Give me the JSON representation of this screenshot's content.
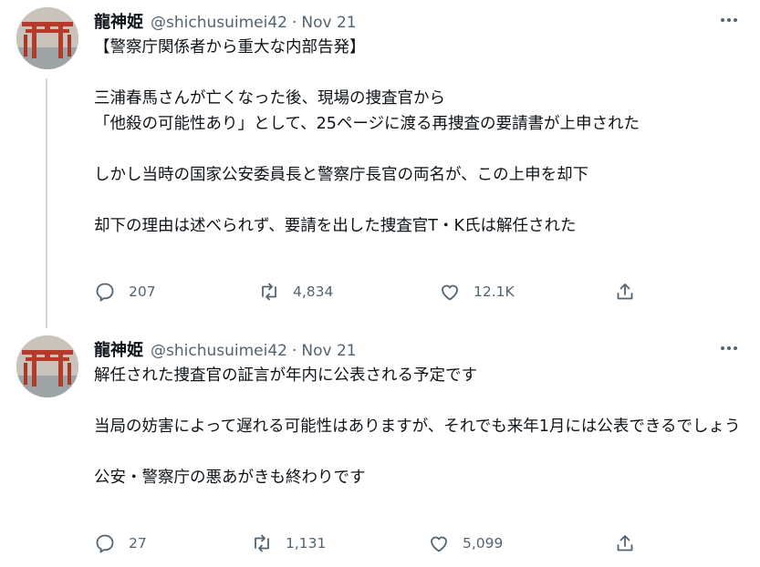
{
  "tweets": [
    {
      "name": "龍神姫",
      "handle": "@shichusuimei42",
      "separator": "·",
      "date": "Nov 21",
      "paragraphs": [
        "【警察庁関係者から重大な内部告発】",
        "三浦春馬さんが亡くなった後、現場の捜査官から\n「他殺の可能性あり」として、25ページに渡る再捜査の要請書が上申された",
        "しかし当時の国家公安委員長と警察庁長官の両名が、この上申を却下",
        "却下の理由は述べられず、要請を出した捜査官T・K氏は解任された"
      ],
      "replies": "207",
      "retweets": "4,834",
      "likes": "12.1K"
    },
    {
      "name": "龍神姫",
      "handle": "@shichusuimei42",
      "separator": "·",
      "date": "Nov 21",
      "paragraphs": [
        "解任された捜査官の証言が年内に公表される予定です",
        "当局の妨害によって遅れる可能性はありますが、それでも来年1月には公表できるでしょう",
        "公安・警察庁の悪あがきも終わりです"
      ],
      "replies": "27",
      "retweets": "1,131",
      "likes": "5,099"
    }
  ],
  "icons": {
    "reply": "reply-icon",
    "retweet": "retweet-icon",
    "like": "heart-icon",
    "share": "share-icon",
    "more": "more-icon"
  },
  "colors": {
    "text": "#0f1419",
    "secondary": "#536471",
    "thread_line": "#cfd9de"
  }
}
